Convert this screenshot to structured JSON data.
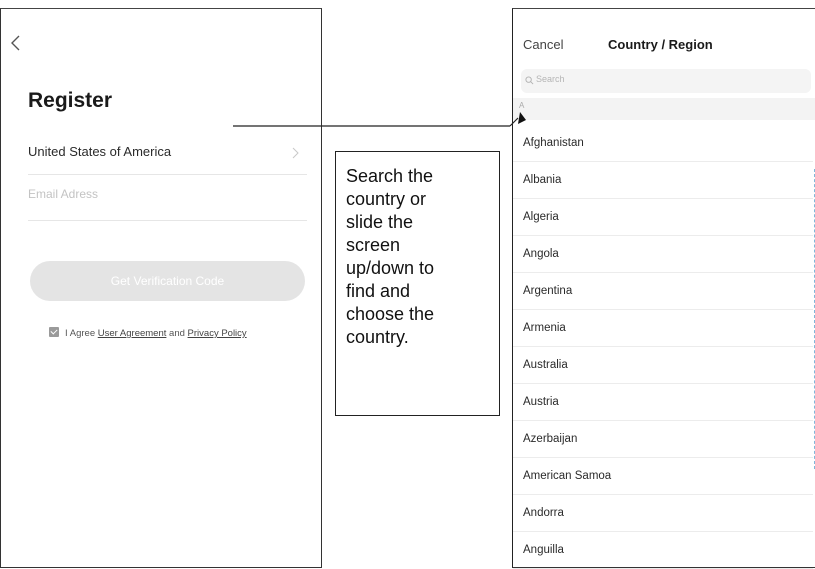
{
  "register": {
    "title": "Register",
    "country_value": "United States of America",
    "email_placeholder": "Email Adress",
    "verify_button": "Get Verification Code",
    "agree_prefix": "I Agree",
    "user_agreement": "User Agreement",
    "agree_and": "and",
    "privacy_policy": "Privacy Policy"
  },
  "callout": {
    "lines": [
      "Search the",
      "country or",
      "slide the",
      "screen",
      "up/down to",
      "find and",
      "choose the",
      "country."
    ]
  },
  "picker": {
    "cancel": "Cancel",
    "title": "Country / Region",
    "search_placeholder": "Search",
    "section": "A",
    "countries": [
      "Afghanistan",
      "Albania",
      "Algeria",
      "Angola",
      "Argentina",
      "Armenia",
      "Australia",
      "Austria",
      "Azerbaijan",
      "American Samoa",
      "Andorra",
      "Anguilla"
    ]
  },
  "colors": {
    "button_disabled": "#e4e4e4",
    "index_bar": "#7fb6d9",
    "frame_border": "#333333"
  }
}
